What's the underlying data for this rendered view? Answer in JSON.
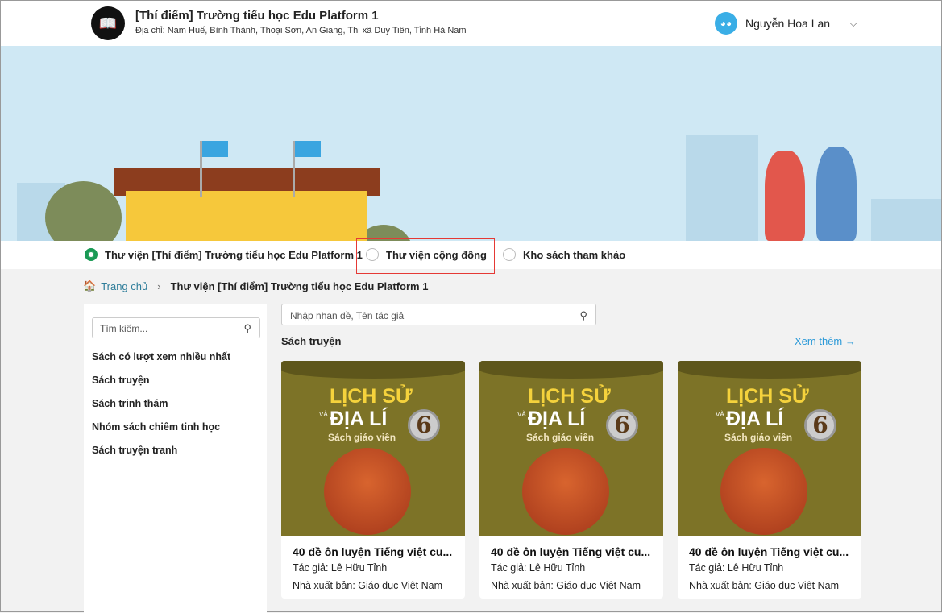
{
  "header": {
    "school_name": "[Thí điểm] Trường tiểu học Edu Platform 1",
    "address": "Địa chỉ: Nam Huế, Bình Thành, Thoại Sơn, An Giang, Thị xã Duy Tiên, Tỉnh Hà Nam",
    "user_name": "Nguyễn Hoa Lan"
  },
  "tabs": [
    {
      "label": "Thư viện [Thí điểm] Trường tiểu học Edu Platform 1",
      "selected": true
    },
    {
      "label": "Thư viện cộng đồng",
      "selected": false
    },
    {
      "label": "Kho sách tham khảo",
      "selected": false
    }
  ],
  "breadcrumb": {
    "home": "Trang chủ",
    "current": "Thư viện [Thí điểm] Trường tiểu học Edu Platform 1"
  },
  "sidebar": {
    "search_placeholder": "Tìm kiếm...",
    "items": [
      "Sách có lượt xem nhiều nhất",
      "Sách truyện",
      "Sách trinh thám",
      "Nhóm sách chiêm tinh học",
      "Sách truyện tranh"
    ]
  },
  "main": {
    "search_placeholder": "Nhập nhan đề, Tên tác giả",
    "section_title": "Sách truyện",
    "see_more": "Xem thêm",
    "books": [
      {
        "cover_line1": "LỊCH SỬ",
        "cover_va": "VÀ",
        "cover_line2": "ĐỊA LÍ",
        "cover_grade": "6",
        "cover_sub": "Sách giáo viên",
        "title": "40 đề ôn luyện Tiếng việt cu...",
        "author": "Tác giả: Lê Hữu Tỉnh",
        "publisher": "Nhà xuất bản: Giáo dục Việt Nam"
      },
      {
        "cover_line1": "LỊCH SỬ",
        "cover_va": "VÀ",
        "cover_line2": "ĐỊA LÍ",
        "cover_grade": "6",
        "cover_sub": "Sách giáo viên",
        "title": "40 đề ôn luyện Tiếng việt cu...",
        "author": "Tác giả: Lê Hữu Tỉnh",
        "publisher": "Nhà xuất bản: Giáo dục Việt Nam"
      },
      {
        "cover_line1": "LỊCH SỬ",
        "cover_va": "VÀ",
        "cover_line2": "ĐỊA LÍ",
        "cover_grade": "6",
        "cover_sub": "Sách giáo viên",
        "title": "40 đề ôn luyện Tiếng việt cu...",
        "author": "Tác giả: Lê Hữu Tỉnh",
        "publisher": "Nhà xuất bản: Giáo dục Việt Nam"
      }
    ]
  }
}
